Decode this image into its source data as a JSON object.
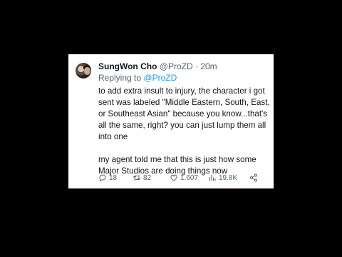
{
  "tweet": {
    "author_name": "SungWon Cho",
    "author_handle": "@ProZD",
    "separator": "·",
    "time": "20m",
    "replying_prefix": "Replying to",
    "replying_handle": "@ProZD",
    "paragraphs": [
      "to add extra insult to injury, the character i got sent was labeled \"Middle Eastern, South, East, or Southeast Asian\" because you know...that's all the same, right? you can just lump them all into one",
      "my agent told me that this is just how some Major Studios are doing things now"
    ],
    "stats": {
      "replies": "18",
      "retweets": "82",
      "likes": "1,607",
      "views": "19.8K"
    }
  },
  "icons": {
    "reply": "speech-bubble-icon",
    "retweet": "retweet-arrows-icon",
    "like": "heart-icon",
    "views": "bar-chart-icon",
    "share": "share-icon"
  },
  "colors": {
    "background": "#000000",
    "card": "#ffffff",
    "text": "#0f1419",
    "muted": "#536471",
    "accent": "#1d9bf0"
  }
}
